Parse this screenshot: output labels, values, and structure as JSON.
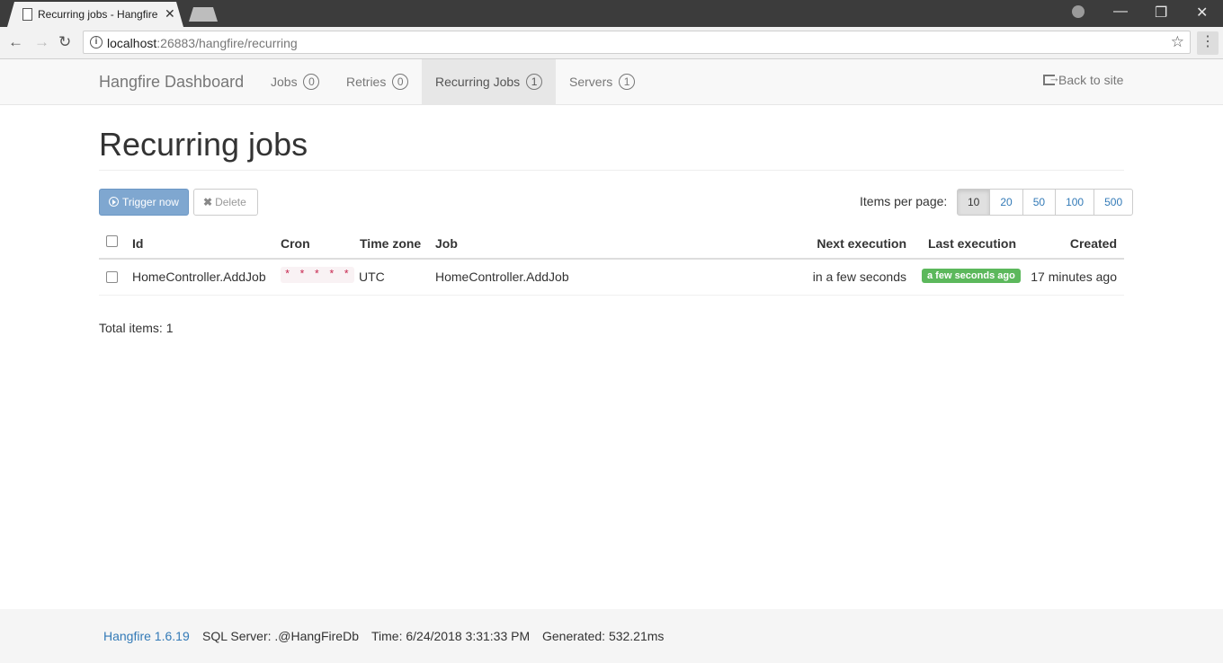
{
  "browser": {
    "tab_title": "Recurring jobs - Hangfire",
    "url_host": "localhost",
    "url_path": ":26883/hangfire/recurring"
  },
  "navbar": {
    "brand": "Hangfire Dashboard",
    "items": [
      {
        "label": "Jobs",
        "count": "0"
      },
      {
        "label": "Retries",
        "count": "0"
      },
      {
        "label": "Recurring Jobs",
        "count": "1"
      },
      {
        "label": "Servers",
        "count": "1"
      }
    ],
    "back_link": "Back to site"
  },
  "page": {
    "title": "Recurring jobs",
    "trigger_button": "Trigger now",
    "delete_button": "Delete",
    "items_per_page_label": "Items per page:",
    "page_sizes": [
      "10",
      "20",
      "50",
      "100",
      "500"
    ],
    "selected_page_size": "10",
    "total_items": "Total items: 1"
  },
  "table": {
    "headers": [
      "Id",
      "Cron",
      "Time zone",
      "Job",
      "Next execution",
      "Last execution",
      "Created"
    ],
    "rows": [
      {
        "id": "HomeController.AddJob",
        "cron": "* * * * *",
        "time_zone": "UTC",
        "job": "HomeController.AddJob",
        "next_execution": "in a few seconds",
        "last_execution": "a few seconds ago",
        "created": "17 minutes ago"
      }
    ]
  },
  "footer": {
    "version": "Hangfire 1.6.19",
    "storage": "SQL Server: .@HangFireDb",
    "time": "Time: 6/24/2018 3:31:33 PM",
    "generated": "Generated: 532.21ms"
  },
  "colors": {
    "success_badge": "#5cb85c",
    "primary_button": "#7fa7d0",
    "link": "#337ab7",
    "cron_text": "#c7254e"
  }
}
